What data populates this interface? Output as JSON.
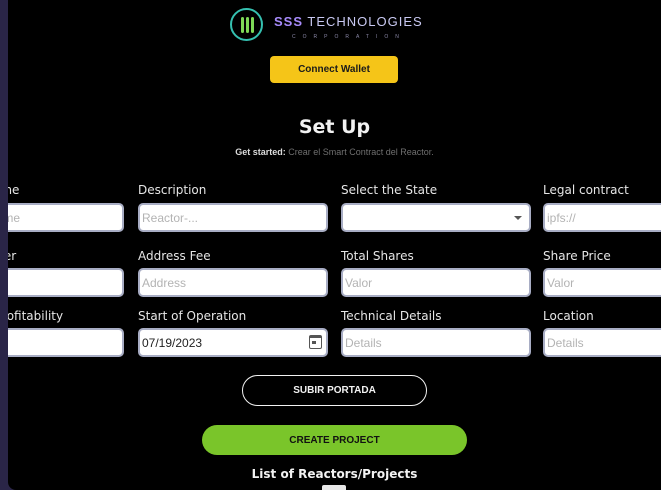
{
  "brand": {
    "name_highlight": "SSS",
    "name_rest": " TECHNOLOGIES",
    "subtitle": "CORPORATION",
    "accent_color": "#7ed957",
    "ring_color": "#35c0b0"
  },
  "header": {
    "connect_wallet_label": "Connect Wallet"
  },
  "setup": {
    "title": "Set Up",
    "subtitle_bold": "Get started:",
    "subtitle_rest": " Crear el Smart Contract del Reactor."
  },
  "form": {
    "row1": [
      {
        "label": "Name",
        "placeholder": "Name",
        "value": ""
      },
      {
        "label": "Description",
        "placeholder": "Reactor-...",
        "value": ""
      },
      {
        "label": "Select the State",
        "placeholder": "",
        "value": ""
      },
      {
        "label": "Legal contract",
        "placeholder": "ipfs://",
        "value": ""
      }
    ],
    "row2": [
      {
        "label": "Owner",
        "placeholder": "",
        "value": ""
      },
      {
        "label": "Address Fee",
        "placeholder": "Address",
        "value": ""
      },
      {
        "label": "Total Shares",
        "placeholder": "Valor",
        "value": ""
      },
      {
        "label": "Share Price",
        "placeholder": "Valor",
        "value": ""
      }
    ],
    "row3": [
      {
        "label": "Profitability",
        "placeholder": "",
        "value": ""
      },
      {
        "label": "Start of Operation",
        "placeholder": "",
        "value": "07/19/2023"
      },
      {
        "label": "Technical Details",
        "placeholder": "Details",
        "value": ""
      },
      {
        "label": "Location",
        "placeholder": "Details",
        "value": ""
      }
    ]
  },
  "actions": {
    "upload_cover_label": "SUBIR PORTADA",
    "create_project_label": "CREATE PROJECT"
  },
  "list": {
    "title": "List of Reactors/Projects"
  }
}
